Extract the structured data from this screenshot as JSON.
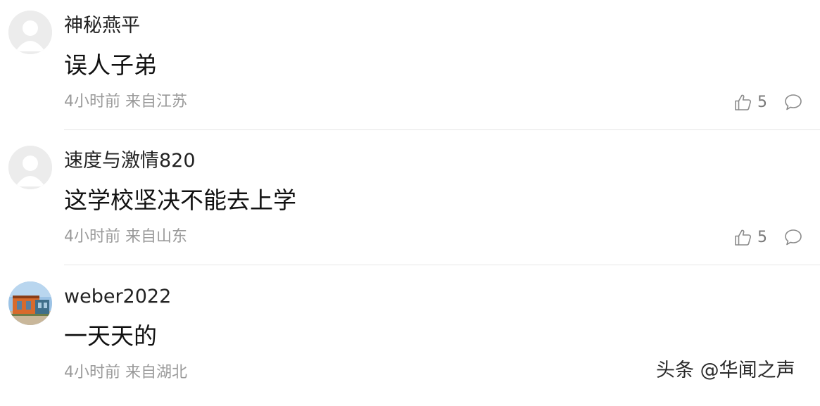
{
  "comments": [
    {
      "username": "神秘燕平",
      "text": "误人子弟",
      "time": "4小时前",
      "location": "来自江苏",
      "likes": "5",
      "avatar": "default-avatar-icon"
    },
    {
      "username": "速度与激情820",
      "text": "这学校坚决不能去上学",
      "time": "4小时前",
      "location": "来自山东",
      "likes": "5",
      "avatar": "default-avatar-icon"
    },
    {
      "username": "weber2022",
      "text": "一天天的",
      "time": "4小时前",
      "location": "来自湖北",
      "likes": "",
      "avatar": "photo-avatar"
    }
  ],
  "icons": {
    "like": "thumbs-up-icon",
    "reply": "comment-bubble-icon"
  },
  "colors": {
    "meta": "#9a9a9a",
    "divider": "#e6e6e6",
    "avatar_placeholder": "#ececec"
  },
  "watermark": "头条 @华闻之声"
}
